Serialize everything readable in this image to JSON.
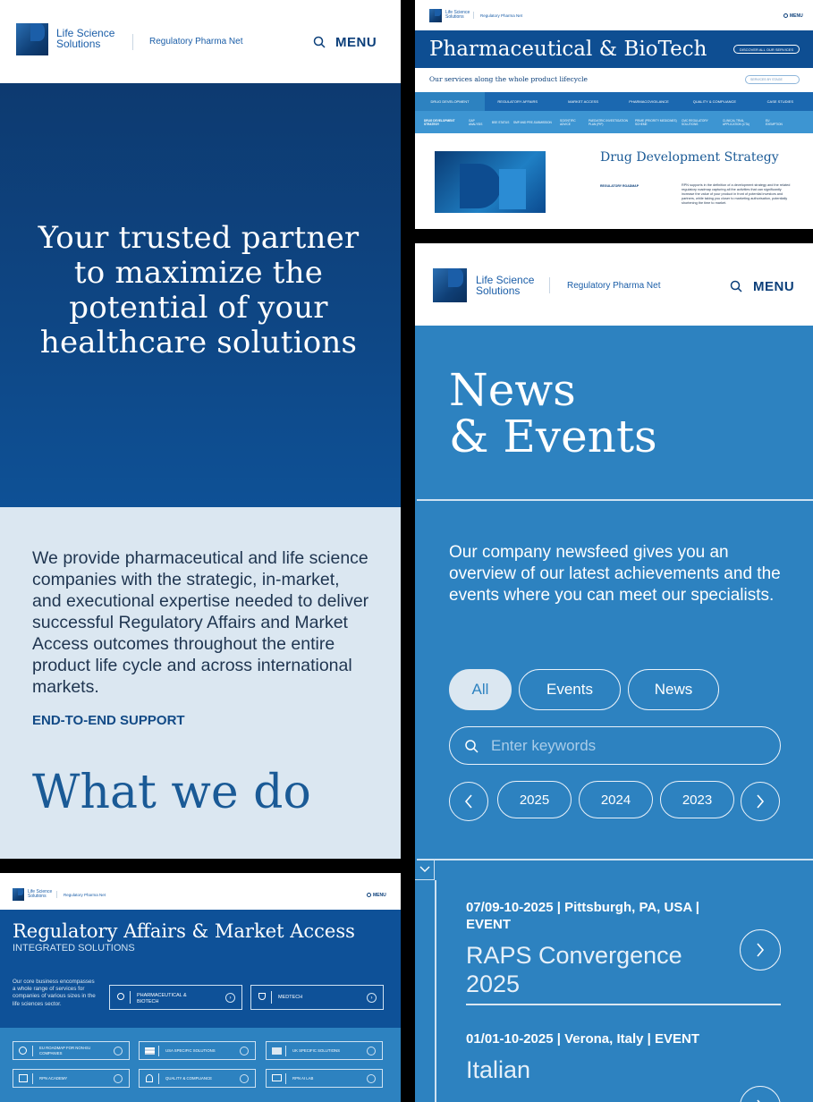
{
  "brand": {
    "name_line1": "Life Science",
    "name_line2": "Solutions",
    "subbrand": "Regulatory Pharma Net"
  },
  "nav": {
    "menu_label": "MENU"
  },
  "hero": {
    "headline": "Your trusted partner to maximize the potential of your healthcare solutions",
    "body": "We provide pharmaceutical and life science companies with the strategic, in-market, and executional expertise needed to deliver successful Regulatory Affairs and Market Access outcomes throughout the entire product life cycle and across international markets.",
    "cta": "END-TO-END SUPPORT",
    "section_heading": "What we do"
  },
  "pharma": {
    "title": "Pharmaceutical & BioTech",
    "discover": "DISCOVER ALL OUR SERVICES",
    "subtitle": "Our services along the whole product lifecycle",
    "select": "SERVICES BY STAGE",
    "tabs": [
      "DRUG DEVELOPMENT",
      "REGULATORY AFFAIRS",
      "MARKET ACCESS",
      "PHARMACOVIGILANCE",
      "QUALITY & COMPLIANCE",
      "CASE STUDIES"
    ],
    "subtabs": [
      "DRUG DEVELOPMENT STRATEGY",
      "GAP ANALYSIS",
      "BSE STATUS",
      "SMP AND PRE-SUBMISSION",
      "SCIENTIFIC ADVICE",
      "PAEDIATRIC INVESTIGATION PLAN (PIP)",
      "PRIME (PRIORITY MEDICINES) SCHEME",
      "CMC REGULATORY SOLUTIONS",
      "CLINICAL TRIAL APPLICATION (CTA)",
      "EU EXEMPTION"
    ],
    "detail_title": "Drug Development Strategy",
    "detail_tag": "REGULATORY ROADMAP",
    "detail_text": "RPN supports in the definition of a development strategy and the related regulatory roadmap capturing all the activities that can significantly increase the value of your product in front of potential investors and partners, while taking you closer to marketing authorisation, potentially shortening the time to market."
  },
  "news": {
    "title_line1": "News",
    "title_line2": "& Events",
    "intro": "Our company newsfeed gives you an overview of our latest achievements and the events where you can meet our specialists.",
    "filters": [
      "All",
      "Events",
      "News"
    ],
    "search_placeholder": "Enter keywords",
    "years": [
      "2025",
      "2024",
      "2023"
    ],
    "items": [
      {
        "meta": "07/09-10-2025 | Pittsburgh, PA, USA | EVENT",
        "title": "RAPS Convergence 2025"
      },
      {
        "meta": "01/01-10-2025 | Verona, Italy | EVENT",
        "title": "Italian"
      }
    ]
  },
  "regaffairs": {
    "title": "Regulatory Affairs & Market Access",
    "subtitle": "INTEGRATED SOLUTIONS",
    "intro": "Our core business encompasses a whole range of services for companies of various sizes in the life sciences sector.",
    "buttons": [
      "PHARMACEUTICAL & BIOTECH",
      "MEDTECH"
    ],
    "solutions": [
      "EU ROADMAP FOR NON-EU COMPANIES",
      "USA SPECIFIC SOLUTIONS",
      "UK SPECIFIC SOLUTIONS",
      "RPN ACADEMY",
      "QUALITY & COMPLIANCE",
      "RPN AI LAB"
    ]
  },
  "colors": {
    "navy": "#0b3f7a",
    "accent": "#2d82c0",
    "light": "#dbe7f1",
    "heading_blue": "#1a5a96"
  }
}
